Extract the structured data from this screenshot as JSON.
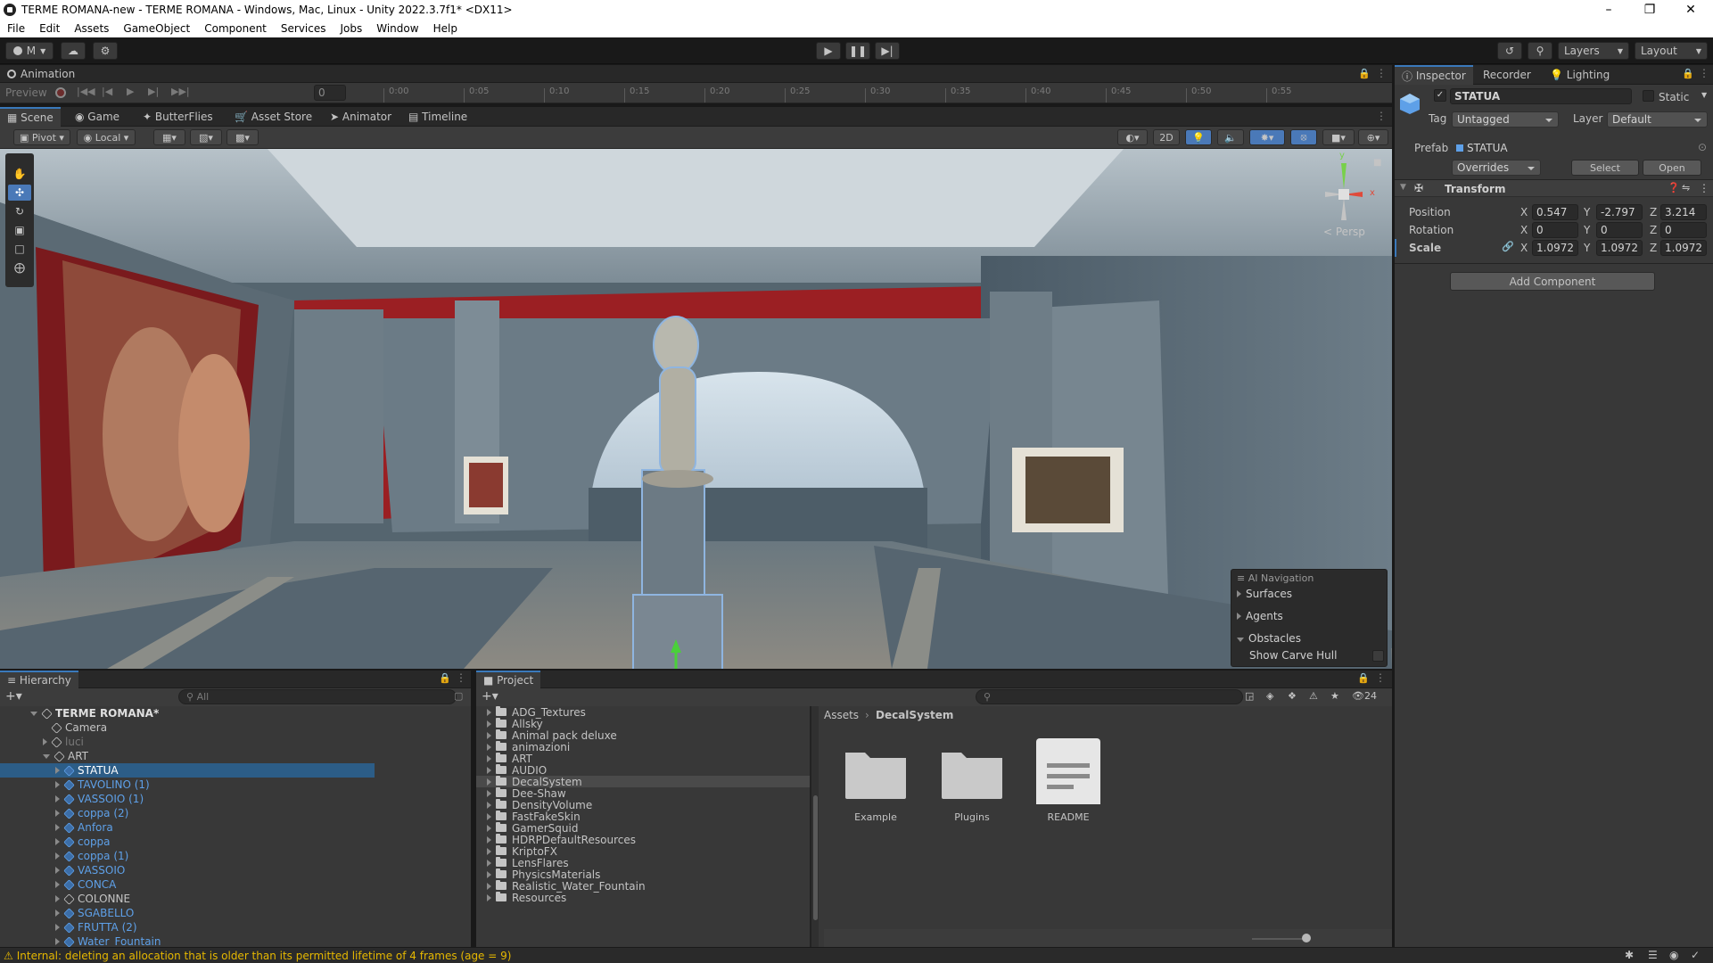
{
  "window": {
    "title": "TERME ROMANA-new - TERME ROMANA - Windows, Mac, Linux - Unity 2022.3.7f1* <DX11>",
    "min_icon": "minimize-icon",
    "max_icon": "maximize-icon",
    "close_icon": "close-icon"
  },
  "menu": [
    "File",
    "Edit",
    "Assets",
    "GameObject",
    "Component",
    "Services",
    "Jobs",
    "Window",
    "Help"
  ],
  "toolbar": {
    "account": "M",
    "layers": "Layers",
    "layout": "Layout"
  },
  "animation": {
    "tab": "Animation",
    "preview": "Preview",
    "frame": "0",
    "ticks": [
      "0:00",
      "0:05",
      "0:10",
      "0:15",
      "0:20",
      "0:25",
      "0:30",
      "0:35",
      "0:40",
      "0:45",
      "0:50",
      "0:55"
    ]
  },
  "scene_tabs": [
    "Scene",
    "Game",
    "ButterFlies",
    "Asset Store",
    "Animator",
    "Timeline"
  ],
  "scene_toolbar": {
    "pivot": "Pivot",
    "local": "Local",
    "mode_2d": "2D",
    "persp": "Persp",
    "gizmo_y": "y",
    "gizmo_x": "x"
  },
  "ai_navigation": {
    "title": "AI Navigation",
    "items": [
      "Surfaces",
      "Agents",
      "Obstacles"
    ],
    "show_carve_hull": "Show Carve Hull"
  },
  "inspector": {
    "tabs": [
      "Inspector",
      "Recorder",
      "Lighting"
    ],
    "object_name": "STATUA",
    "static_label": "Static",
    "tag_label": "Tag",
    "tag_value": "Untagged",
    "layer_label": "Layer",
    "layer_value": "Default",
    "prefab_label": "Prefab",
    "prefab_value": "STATUA",
    "overrides": "Overrides",
    "select": "Select",
    "open": "Open",
    "transform": "Transform",
    "position": {
      "label": "Position",
      "x": "0.547",
      "y": "-2.797",
      "z": "3.214"
    },
    "rotation": {
      "label": "Rotation",
      "x": "0",
      "y": "0",
      "z": "0"
    },
    "scale": {
      "label": "Scale",
      "x": "1.0972",
      "y": "1.0972",
      "z": "1.0972"
    },
    "add_component": "Add Component"
  },
  "hierarchy": {
    "tab": "Hierarchy",
    "search_placeholder": "All",
    "rows": [
      {
        "label": "TERME ROMANA*",
        "kind": "scene"
      },
      {
        "label": "Camera",
        "kind": "obj"
      },
      {
        "label": "luci",
        "kind": "disabled"
      },
      {
        "label": "ART",
        "kind": "obj"
      },
      {
        "label": "STATUA",
        "kind": "prefab"
      },
      {
        "label": "TAVOLINO (1)",
        "kind": "prefab"
      },
      {
        "label": "VASSOIO (1)",
        "kind": "prefab"
      },
      {
        "label": "coppa (2)",
        "kind": "prefab"
      },
      {
        "label": "Anfora",
        "kind": "prefab"
      },
      {
        "label": "coppa",
        "kind": "prefab"
      },
      {
        "label": "coppa (1)",
        "kind": "prefab"
      },
      {
        "label": "VASSOIO",
        "kind": "prefab"
      },
      {
        "label": "CONCA",
        "kind": "prefab"
      },
      {
        "label": "COLONNE",
        "kind": "obj"
      },
      {
        "label": "SGABELLO",
        "kind": "prefab"
      },
      {
        "label": "FRUTTA (2)",
        "kind": "prefab"
      },
      {
        "label": "Water_Fountain",
        "kind": "prefab"
      }
    ]
  },
  "project": {
    "tab": "Project",
    "badge": "24",
    "folders": [
      "ADG_Textures",
      "Allsky",
      "Animal pack deluxe",
      "animazioni",
      "ART",
      "AUDIO",
      "DecalSystem",
      "Dee-Shaw",
      "DensityVolume",
      "FastFakeSkin",
      "GamerSquid",
      "HDRPDefaultResources",
      "KriptoFX",
      "LensFlares",
      "PhysicsMaterials",
      "Realistic_Water_Fountain",
      "Resources"
    ],
    "breadcrumb": [
      "Assets",
      "DecalSystem"
    ],
    "assets": [
      "Example",
      "Plugins",
      "README"
    ]
  },
  "status": {
    "message": "Internal: deleting an allocation that is older than its permitted lifetime of 4 frames (age = 9)",
    "color": "#e6b800"
  }
}
